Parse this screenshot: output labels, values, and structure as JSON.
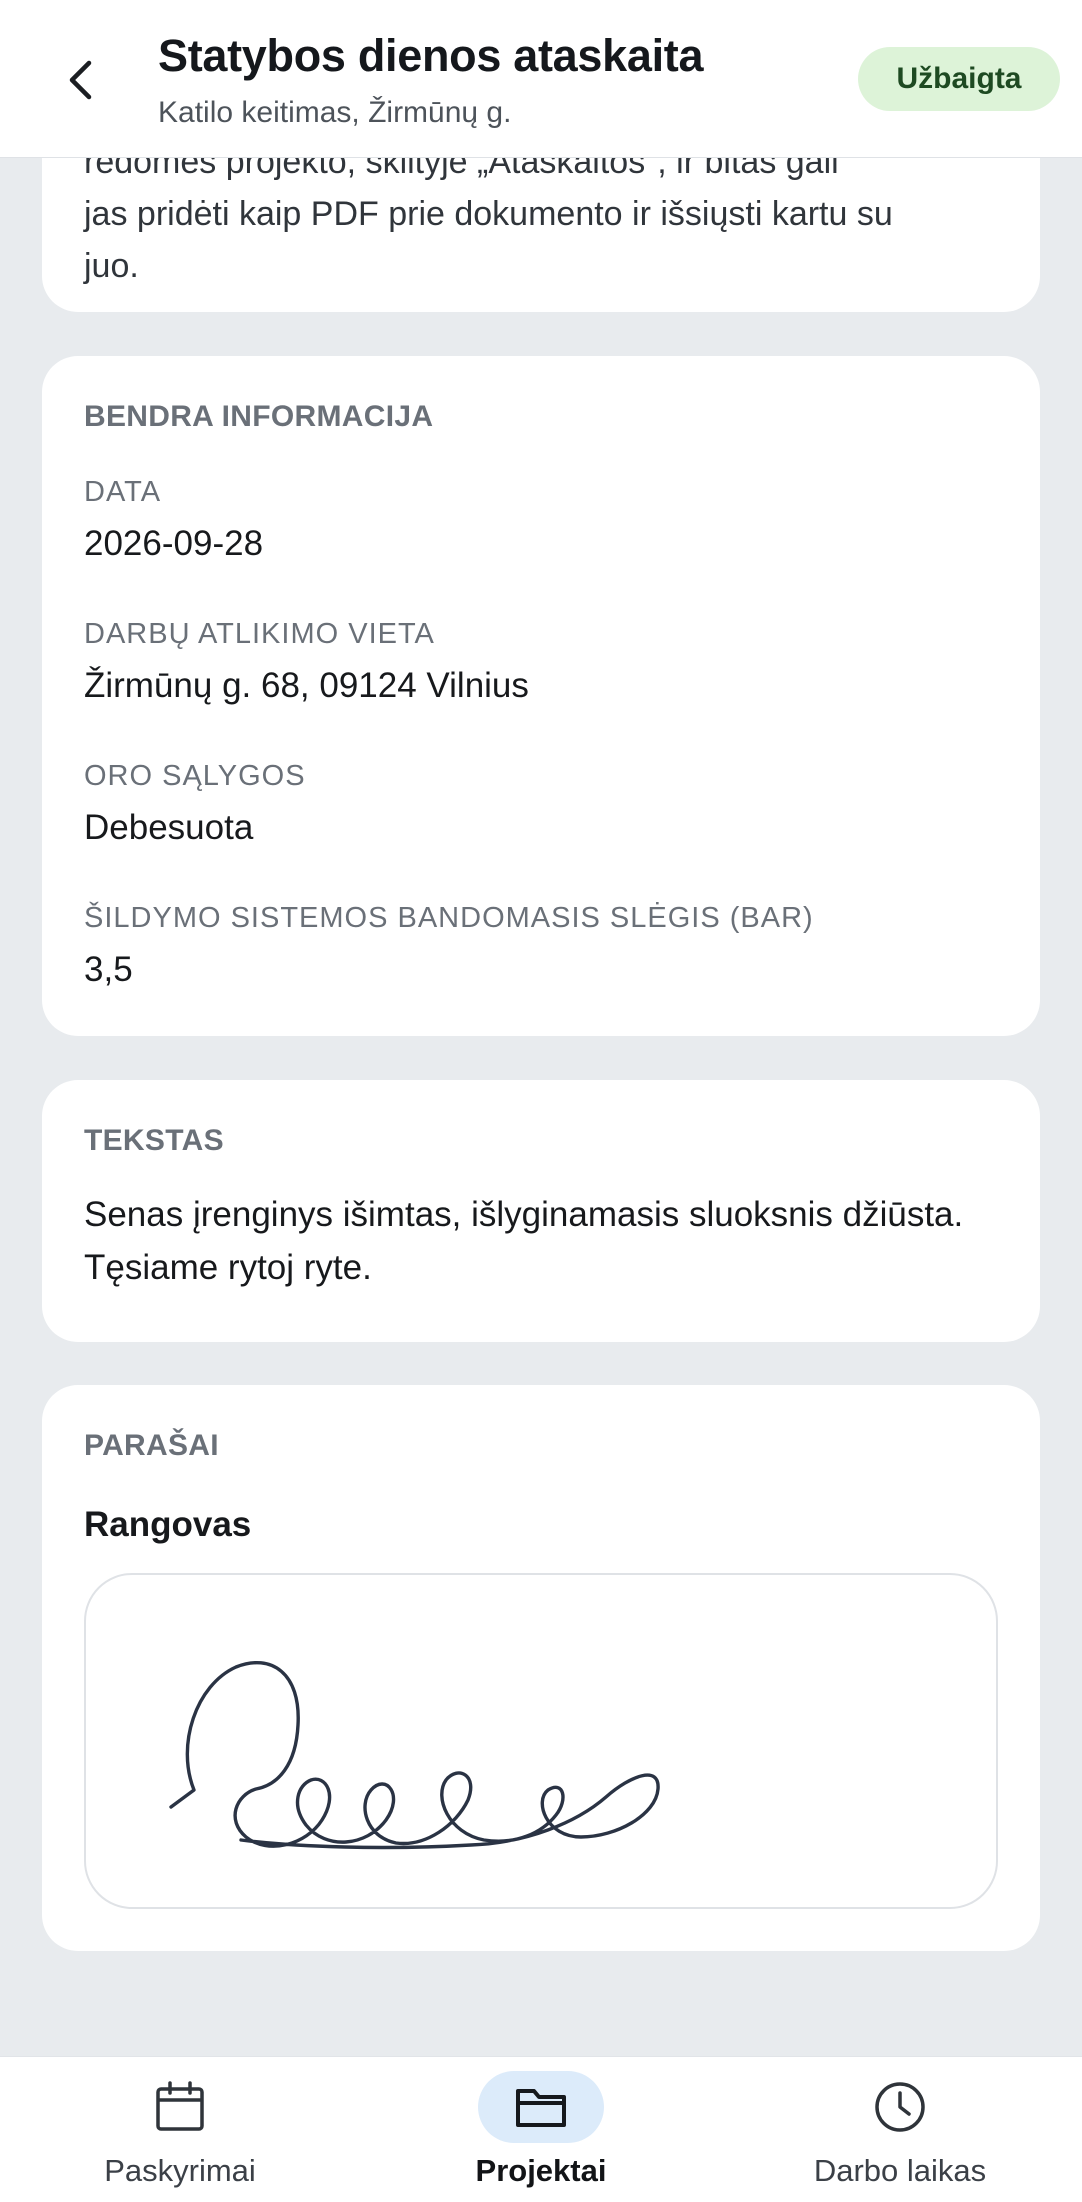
{
  "header": {
    "title": "Statybos dienos ataskaita",
    "subtitle": "Katilo keitimas, Žirmūnų g.",
    "status": "Užbaigta",
    "status_bg": "#ddf3d8",
    "status_fg": "#1e4a22",
    "back_icon": "chevron-left-icon"
  },
  "intro": {
    "line_partial": "redomes projekto, skiltyje „Ataskaitos\", ir bitas gali",
    "line2": "jas pridėti kaip PDF prie dokumento ir išsiųsti kartu su",
    "line3": "juo."
  },
  "general": {
    "section_title": "BENDRA INFORMACIJA",
    "fields": [
      {
        "label": "DATA",
        "value": "2026-09-28"
      },
      {
        "label": "DARBŲ ATLIKIMO VIETA",
        "value": "Žirmūnų g. 68, 09124 Vilnius"
      },
      {
        "label": "ORO SĄLYGOS",
        "value": "Debesuota"
      },
      {
        "label": "ŠILDYMO SISTEMOS BANDOMASIS SLĖGIS (BAR)",
        "value": "3,5"
      }
    ]
  },
  "text_section": {
    "section_title": "TEKSTAS",
    "body": "Senas įrenginys išimtas, išlyginamasis sluoksnis džiūsta. Tęsiame rytoj ryte."
  },
  "signatures": {
    "section_title": "PARAŠAI",
    "role": "Rangovas",
    "signature_color": "#2a3344"
  },
  "bottom_nav": {
    "active_bg": "#dcebfa",
    "items": [
      {
        "label": "Paskyrimai",
        "icon": "calendar-icon",
        "active": false
      },
      {
        "label": "Projektai",
        "icon": "folder-icon",
        "active": true
      },
      {
        "label": "Darbo laikas",
        "icon": "clock-icon",
        "active": false
      }
    ]
  }
}
